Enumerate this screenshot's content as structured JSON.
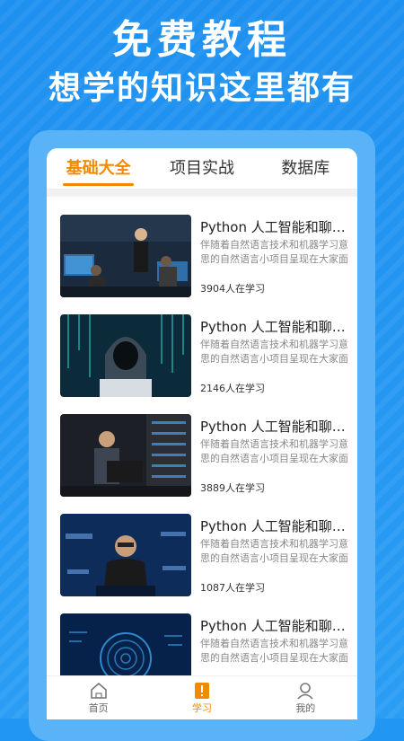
{
  "promo": {
    "title": "免费教程",
    "subtitle": "想学的知识这里都有"
  },
  "tabs": [
    {
      "label": "基础大全",
      "active": true
    },
    {
      "label": "项目实战",
      "active": false
    },
    {
      "label": "数据库",
      "active": false
    }
  ],
  "courses": [
    {
      "title": "Python 人工智能和聊天机器人",
      "desc": "伴随着自然语言技术和机器学习意思的自然语言小项目呈现在大家面前",
      "count": "3904人在学习",
      "thumb": "office-monitor-meeting"
    },
    {
      "title": "Python 人工智能和聊天机器人",
      "desc": "伴随着自然语言技术和机器学习意思的自然语言小项目呈现在大家面前",
      "count": "2146人在学习",
      "thumb": "hooded-hacker"
    },
    {
      "title": "Python 人工智能和聊天机器人",
      "desc": "伴随着自然语言技术和机器学习意思的自然语言小项目呈现在大家面前",
      "count": "3889人在学习",
      "thumb": "server-room-laptop"
    },
    {
      "title": "Python 人工智能和聊天机器人",
      "desc": "伴随着自然语言技术和机器学习意思的自然语言小项目呈现在大家面前",
      "count": "1087人在学习",
      "thumb": "password-hacker"
    },
    {
      "title": "Python 人工智能和聊天机器人",
      "desc": "伴随着自然语言技术和机器学习意思的自然语言小项目呈现在大家面前",
      "count": "",
      "thumb": "fingerprint-tech"
    }
  ],
  "nav": [
    {
      "label": "首页",
      "icon": "home-icon",
      "active": false
    },
    {
      "label": "学习",
      "icon": "book-icon",
      "active": true
    },
    {
      "label": "我的",
      "icon": "user-icon",
      "active": false
    }
  ],
  "colors": {
    "background": "#2196f3",
    "accent": "#f08a00",
    "phone_frame": "#5ab3f7"
  }
}
